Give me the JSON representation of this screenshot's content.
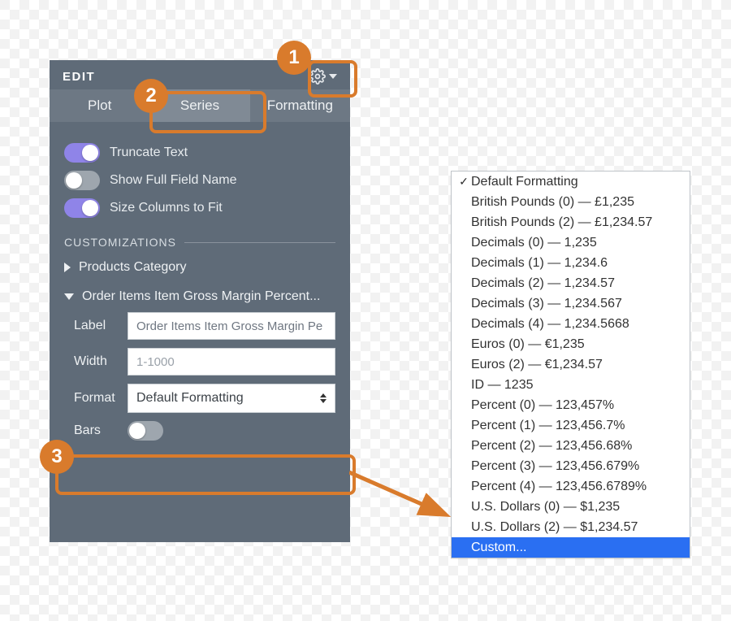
{
  "panel": {
    "title": "EDIT",
    "tabs": [
      "Plot",
      "Series",
      "Formatting"
    ],
    "toggles": {
      "truncate": "Truncate Text",
      "showFull": "Show Full Field Name",
      "sizeCols": "Size Columns to Fit"
    },
    "sectionTitle": "CUSTOMIZATIONS",
    "expanders": {
      "products": "Products Category",
      "orderItems": "Order Items Item Gross Margin Percent..."
    },
    "fields": {
      "labelLabel": "Label",
      "labelValue": "Order Items Item Gross Margin Pe",
      "widthLabel": "Width",
      "widthPlaceholder": "1-1000",
      "formatLabel": "Format",
      "formatValue": "Default Formatting",
      "barsLabel": "Bars"
    }
  },
  "annotations": {
    "one": "1",
    "two": "2",
    "three": "3"
  },
  "menu": {
    "selectedIndex": 0,
    "highlightIndex": 18,
    "items": [
      "Default Formatting",
      "British Pounds (0) — £1,235",
      "British Pounds (2) — £1,234.57",
      "Decimals (0) — 1,235",
      "Decimals (1) — 1,234.6",
      "Decimals (2) — 1,234.57",
      "Decimals (3) — 1,234.567",
      "Decimals (4) — 1,234.5668",
      "Euros (0) — €1,235",
      "Euros (2) — €1,234.57",
      "ID — 1235",
      "Percent (0) — 123,457%",
      "Percent (1) — 123,456.7%",
      "Percent (2) — 123,456.68%",
      "Percent (3) — 123,456.679%",
      "Percent (4) — 123,456.6789%",
      "U.S. Dollars (0) — $1,235",
      "U.S. Dollars (2) — $1,234.57",
      "Custom..."
    ]
  }
}
